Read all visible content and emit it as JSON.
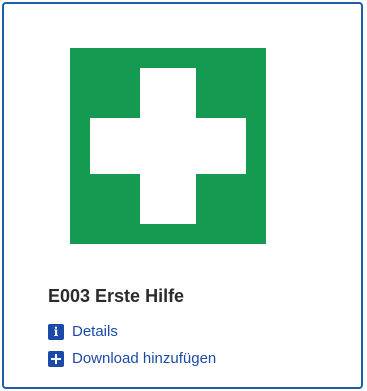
{
  "card": {
    "accent_color": "#1b5fa8",
    "image_icon": "first-aid-sign-icon",
    "sign_color": "#159a52",
    "title": "E003 Erste Hilfe",
    "links": {
      "details": {
        "label": "Details",
        "icon": "info-icon"
      },
      "download": {
        "label": "Download hinzufügen",
        "icon": "plus-square-icon"
      }
    }
  }
}
